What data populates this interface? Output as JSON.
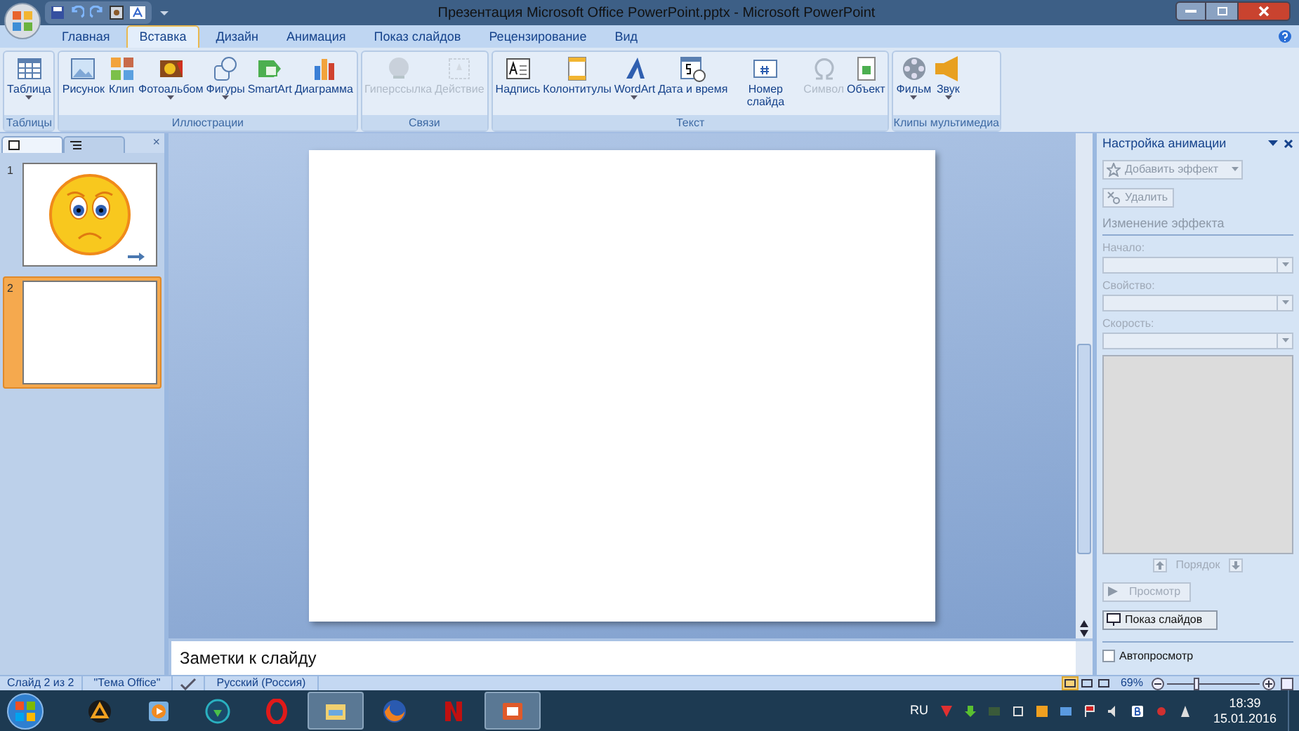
{
  "window": {
    "title": "Презентация Microsoft Office PowerPoint.pptx - Microsoft PowerPoint"
  },
  "tabs": [
    {
      "label": "Главная",
      "selected": false
    },
    {
      "label": "Вставка",
      "selected": true
    },
    {
      "label": "Дизайн",
      "selected": false
    },
    {
      "label": "Анимация",
      "selected": false
    },
    {
      "label": "Показ слайдов",
      "selected": false
    },
    {
      "label": "Рецензирование",
      "selected": false
    },
    {
      "label": "Вид",
      "selected": false
    }
  ],
  "ribbon": {
    "groups": [
      {
        "label": "Таблицы",
        "items": [
          {
            "label": "Таблица",
            "dropdown": true,
            "disabled": false
          }
        ]
      },
      {
        "label": "Иллюстрации",
        "items": [
          {
            "label": "Рисунок",
            "dropdown": false,
            "disabled": false
          },
          {
            "label": "Клип",
            "dropdown": false,
            "disabled": false
          },
          {
            "label": "Фотоальбом",
            "dropdown": true,
            "disabled": false
          },
          {
            "label": "Фигуры",
            "dropdown": true,
            "disabled": false
          },
          {
            "label": "SmartArt",
            "dropdown": false,
            "disabled": false
          },
          {
            "label": "Диаграмма",
            "dropdown": false,
            "disabled": false
          }
        ]
      },
      {
        "label": "Связи",
        "items": [
          {
            "label": "Гиперссылка",
            "dropdown": false,
            "disabled": true
          },
          {
            "label": "Действие",
            "dropdown": false,
            "disabled": true
          }
        ]
      },
      {
        "label": "Текст",
        "items": [
          {
            "label": "Надпись",
            "dropdown": false,
            "disabled": false
          },
          {
            "label": "Колонтитулы",
            "dropdown": false,
            "disabled": false
          },
          {
            "label": "WordArt",
            "dropdown": true,
            "disabled": false
          },
          {
            "label": "Дата и время",
            "dropdown": false,
            "disabled": false
          },
          {
            "label": "Номер слайда",
            "dropdown": false,
            "disabled": false
          },
          {
            "label": "Символ",
            "dropdown": false,
            "disabled": true
          },
          {
            "label": "Объект",
            "dropdown": false,
            "disabled": false
          }
        ]
      },
      {
        "label": "Клипы мультимедиа",
        "items": [
          {
            "label": "Фильм",
            "dropdown": true,
            "disabled": false
          },
          {
            "label": "Звук",
            "dropdown": true,
            "disabled": false
          }
        ]
      }
    ]
  },
  "slides_panel": {
    "tabs": [
      {
        "selected": true
      },
      {
        "selected": false
      }
    ],
    "close": "×",
    "slides": [
      {
        "number": "1",
        "selected": false
      },
      {
        "number": "2",
        "selected": true
      }
    ]
  },
  "notes": {
    "placeholder": "Заметки к слайду"
  },
  "task_pane": {
    "title": "Настройка анимации",
    "add_effect": "Добавить эффект",
    "remove": "Удалить",
    "section": "Изменение эффекта",
    "fields": [
      {
        "label": "Начало:"
      },
      {
        "label": "Свойство:"
      },
      {
        "label": "Скорость:"
      }
    ],
    "order": "Порядок",
    "preview": "Просмотр",
    "slideshow": "Показ слайдов",
    "autopreview": {
      "label": "Автопросмотр",
      "checked": false
    }
  },
  "status_bar": {
    "slide": "Слайд 2 из 2",
    "theme": "\"Тема Office\"",
    "language": "Русский (Россия)",
    "views": [
      {
        "selected": true
      },
      {
        "selected": false
      },
      {
        "selected": false
      }
    ],
    "zoom": "69%",
    "zoom_slider": {
      "level": 0.3
    }
  },
  "taskbar": {
    "apps": [
      {
        "active": false
      },
      {
        "active": false
      },
      {
        "active": false
      },
      {
        "active": false
      },
      {
        "active": true
      },
      {
        "active": false
      },
      {
        "active": false
      },
      {
        "active": true
      }
    ],
    "language": "RU",
    "time": "18:39",
    "date": "15.01.2016"
  }
}
